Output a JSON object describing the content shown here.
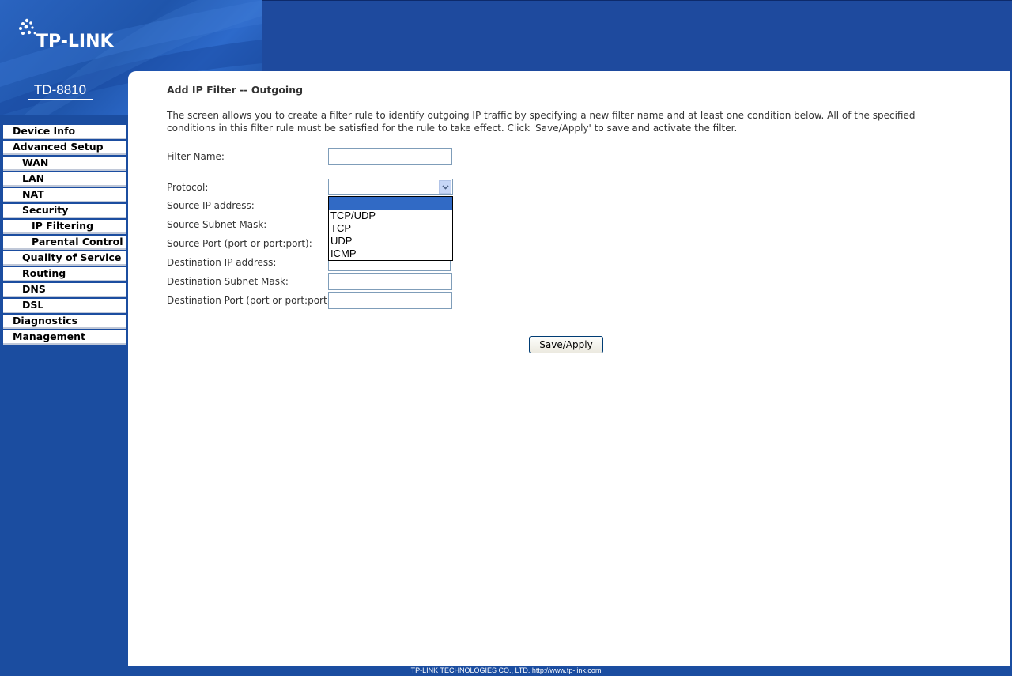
{
  "brand": {
    "logo_text": "TP-LINK",
    "model": "TD-8810"
  },
  "sidebar": {
    "items": [
      {
        "label": "Device Info",
        "level": 0
      },
      {
        "label": "Advanced Setup",
        "level": 0
      },
      {
        "label": "WAN",
        "level": 1
      },
      {
        "label": "LAN",
        "level": 1
      },
      {
        "label": "NAT",
        "level": 1
      },
      {
        "label": "Security",
        "level": 1
      },
      {
        "label": "IP Filtering",
        "level": 2
      },
      {
        "label": "Parental Control",
        "level": 2
      },
      {
        "label": "Quality of Service",
        "level": 1
      },
      {
        "label": "Routing",
        "level": 1
      },
      {
        "label": "DNS",
        "level": 1
      },
      {
        "label": "DSL",
        "level": 1
      },
      {
        "label": "Diagnostics",
        "level": 0
      },
      {
        "label": "Management",
        "level": 0
      }
    ]
  },
  "main": {
    "title": "Add IP Filter -- Outgoing",
    "description": "The screen allows you to create a filter rule to identify outgoing IP traffic by specifying a new filter name and at least one condition below. All of the specified conditions in this filter rule must be satisfied for the rule to take effect. Click 'Save/Apply' to save and activate the filter.",
    "form": {
      "filter_name_label": "Filter Name:",
      "filter_name_value": "",
      "protocol_label": "Protocol:",
      "protocol_value": "",
      "protocol_options": [
        "",
        "TCP/UDP",
        "TCP",
        "UDP",
        "ICMP"
      ],
      "src_ip_label": "Source IP address:",
      "src_mask_label": "Source Subnet Mask:",
      "src_port_label": "Source Port (port or port:port):",
      "dst_ip_label": "Destination IP address:",
      "dst_mask_label": "Destination Subnet Mask:",
      "dst_port_label": "Destination Port (port or port:port):",
      "src_ip_value": "",
      "src_mask_value": "",
      "src_port_value": "",
      "dst_ip_value": "",
      "dst_mask_value": "",
      "dst_port_value": ""
    },
    "save_label": "Save/Apply"
  },
  "footer": {
    "text": "TP-LINK TECHNOLOGIES CO., LTD. http://www.tp-link.com"
  },
  "colors": {
    "brand_blue": "#1b4da0",
    "selection_blue": "#316ac5"
  },
  "icons": {
    "dropdown_arrow": "chevron-down-icon"
  }
}
